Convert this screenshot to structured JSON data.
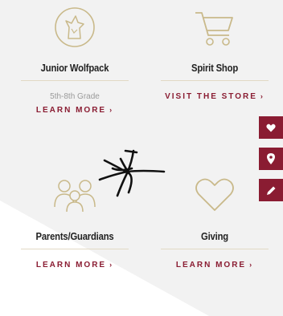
{
  "cards": [
    {
      "title": "Junior Wolfpack",
      "subtitle": "5th-8th Grade",
      "cta": "LEARN MORE",
      "icon": "wolf-emblem-icon"
    },
    {
      "title": "Spirit Shop",
      "cta": "VISIT THE STORE",
      "icon": "shopping-cart-icon"
    },
    {
      "title": "Parents/Guardians",
      "cta": "LEARN MORE",
      "icon": "family-icon"
    },
    {
      "title": "Giving",
      "cta": "LEARN MORE",
      "icon": "heart-outline-icon"
    }
  ],
  "chevron": "›",
  "side_buttons": [
    "heart-icon",
    "location-pin-icon",
    "pencil-icon"
  ],
  "colors": {
    "accent": "#8a1c32",
    "gold": "#c9b98a",
    "background": "#f2f2f2"
  }
}
